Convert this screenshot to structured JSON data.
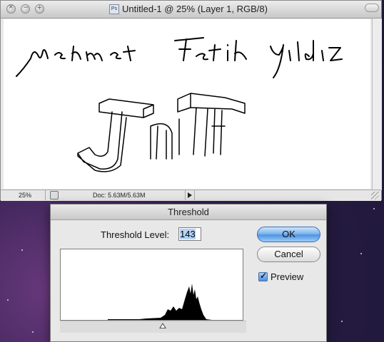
{
  "document_window": {
    "title": "Untitled-1 @ 25% (Layer 1, RGB/8)",
    "app_badge": "Ps",
    "zoom": "25%",
    "doc_size": "Doc: 5.63M/5.63M",
    "canvas_text": {
      "line1": "Mehmet Fatih Yıldız",
      "drawing_letters": "JnF"
    }
  },
  "threshold_dialog": {
    "title": "Threshold",
    "level_label": "Threshold Level:",
    "level_value": "143",
    "ok_label": "OK",
    "cancel_label": "Cancel",
    "preview_label": "Preview",
    "preview_checked": true,
    "histogram": {
      "levels": 256,
      "threshold": 143
    }
  },
  "colors": {
    "ok_button": "#4e95e3",
    "selection": "#b5d3f5",
    "desktop": "#241a40"
  }
}
